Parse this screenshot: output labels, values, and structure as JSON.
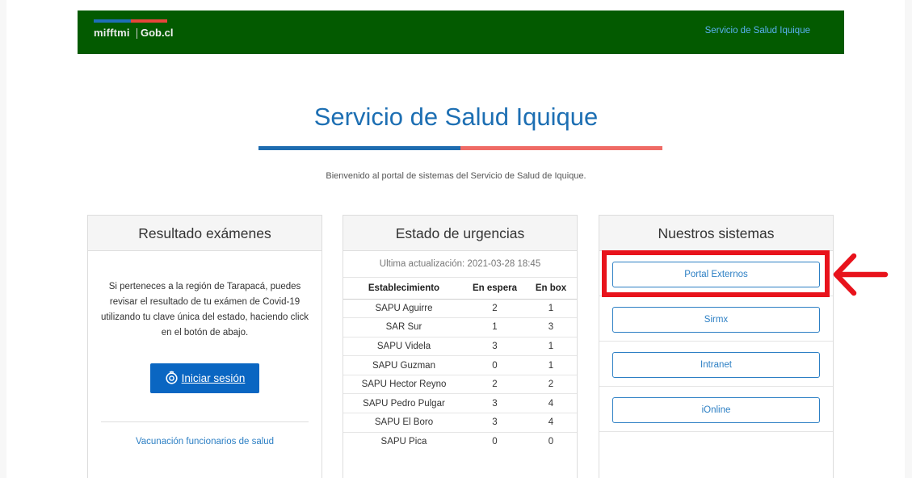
{
  "header": {
    "brand_logo_text": "mifftmi",
    "brand_gob": "Gob.cl",
    "link": "Servicio de Salud Iquique",
    "stripe_colors": [
      "#1f6fb8",
      "#e8453c"
    ],
    "bg_color": "#035a00"
  },
  "hero": {
    "title": "Servicio de Salud Iquique",
    "subtitle": "Bienvenido al portal de sistemas del Servicio de Salud de Iquique.",
    "bar_colors": [
      "#1e6cb0",
      "#ef6b66"
    ]
  },
  "resultados": {
    "title": "Resultado exámenes",
    "text": "Si perteneces a la región de Tarapacá, puedes revisar el resultado de tu exámen de Covid-19 utilizando tu clave única del estado, haciendo click en el botón de abajo.",
    "login_label": "Iniciar sesión",
    "login_icon": "clave-unica-icon",
    "link_vacunacion": "Vacunación funcionarios de salud"
  },
  "urgencias": {
    "title": "Estado de urgencias",
    "updated": "Ultima actualización: 2021-03-28 18:45",
    "columns": [
      "Establecimiento",
      "En espera",
      "En box"
    ],
    "rows": [
      [
        "SAPU Aguirre",
        "2",
        "1"
      ],
      [
        "SAR Sur",
        "1",
        "3"
      ],
      [
        "SAPU Videla",
        "3",
        "1"
      ],
      [
        "SAPU Guzman",
        "0",
        "1"
      ],
      [
        "SAPU Hector Reyno",
        "2",
        "2"
      ],
      [
        "SAPU Pedro Pulgar",
        "3",
        "4"
      ],
      [
        "SAPU El Boro",
        "3",
        "4"
      ],
      [
        "SAPU Pica",
        "0",
        "0"
      ]
    ]
  },
  "sistemas": {
    "title": "Nuestros sistemas",
    "buttons": [
      "Portal Externos",
      "Sirmx",
      "Intranet",
      "iOnline"
    ]
  },
  "annotation": {
    "color": "#e8131c",
    "target": "Portal Externos",
    "arrow_icon": "left-arrow-icon"
  }
}
